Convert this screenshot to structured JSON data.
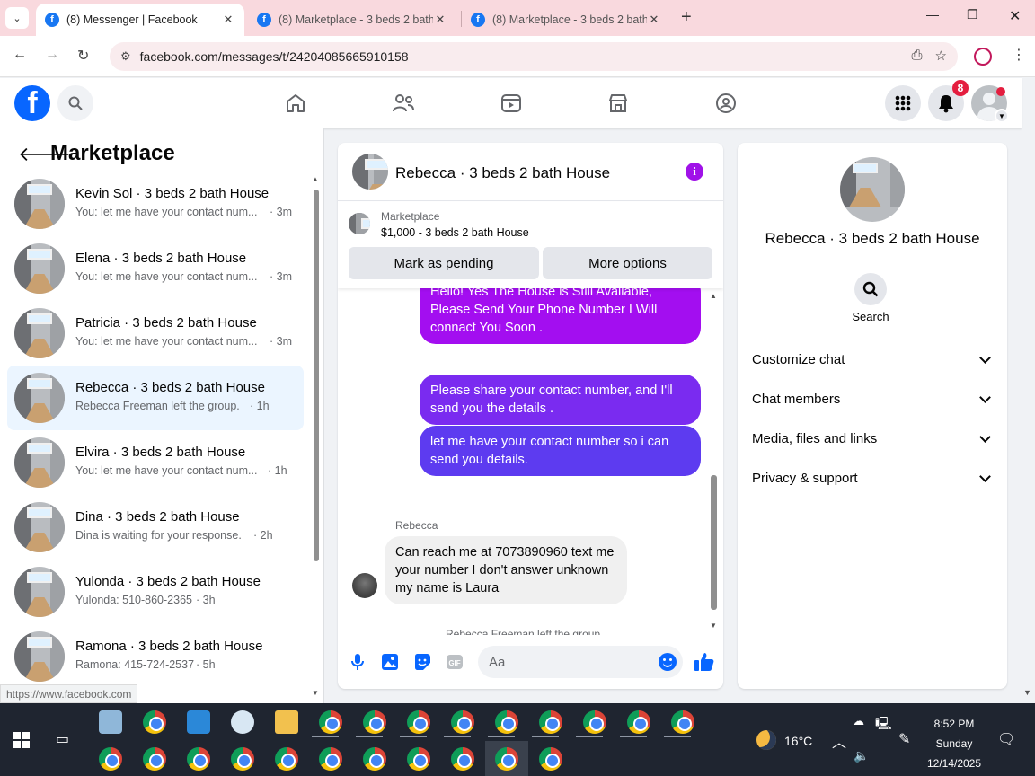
{
  "browser": {
    "tabs": [
      {
        "title": "(8) Messenger | Facebook",
        "active": true
      },
      {
        "title": "(8) Marketplace - 3 beds 2 bath",
        "active": false
      },
      {
        "title": "(8) Marketplace - 3 beds 2 bath",
        "active": false
      }
    ],
    "url": "facebook.com/messages/t/24204085665910158",
    "status_url": "https://www.facebook.com"
  },
  "header": {
    "notification_count": "8"
  },
  "sidebar": {
    "title": "Marketplace",
    "conversations": [
      {
        "name": "Kevin Sol · 3 beds 2 bath House",
        "snippet": "You: let me have your contact num...",
        "time": "· 3m",
        "selected": false
      },
      {
        "name": "Elena · 3 beds 2 bath House",
        "snippet": "You: let me have your contact num...",
        "time": "· 3m",
        "selected": false
      },
      {
        "name": "Patricia · 3 beds 2 bath House",
        "snippet": "You: let me have your contact num...",
        "time": "· 3m",
        "selected": false
      },
      {
        "name": "Rebecca · 3 beds 2 bath House",
        "snippet": "Rebecca Freeman left the group.",
        "time": "· 1h",
        "selected": true
      },
      {
        "name": "Elvira · 3 beds 2 bath House",
        "snippet": "You: let me have your contact num...",
        "time": "· 1h",
        "selected": false
      },
      {
        "name": "Dina · 3 beds 2 bath House",
        "snippet": "Dina is waiting for your response.",
        "time": "· 2h",
        "selected": false
      },
      {
        "name": "Yulonda · 3 beds 2 bath House",
        "snippet": "Yulonda: 510-860-2365",
        "time": "· 3h",
        "selected": false
      },
      {
        "name": "Ramona · 3 beds 2 bath House",
        "snippet": "Ramona: 415-724-2537",
        "time": "· 5h",
        "selected": false
      }
    ]
  },
  "chat": {
    "title": "Rebecca · 3 beds 2 bath House",
    "marketplace_label": "Marketplace",
    "listing": "$1,000 - 3 beds 2 bath House",
    "mark_pending_label": "Mark as pending",
    "more_options_label": "More options",
    "messages": [
      {
        "text": "Hello! Yes The House  is Still Available, Please Send Your Phone Number I Will connact You Soon ."
      },
      {
        "text": "Please share your contact number, and I'll send you the details ."
      },
      {
        "text": "let me have your contact number so i can send you details."
      }
    ],
    "incoming_sender": "Rebecca",
    "incoming_text": "Can reach me at 7073890960 text me your number I don't answer unknown my name is Laura",
    "system_message": "Rebecca Freeman left the group.",
    "input_placeholder": "Aa"
  },
  "details": {
    "name": "Rebecca · 3 beds 2 bath House",
    "search_label": "Search",
    "sections": [
      "Customize chat",
      "Chat members",
      "Media, files and links",
      "Privacy & support"
    ]
  },
  "taskbar": {
    "temperature": "16°C",
    "time": "8:52 PM",
    "day": "Sunday",
    "date": "12/14/2025"
  },
  "colors": {
    "fb_blue": "#0866ff",
    "bubble_top": "#a30ef0",
    "bubble_bottom": "#5d3bf0",
    "selected_row": "#ebf5ff",
    "notification": "#e41e3f"
  }
}
